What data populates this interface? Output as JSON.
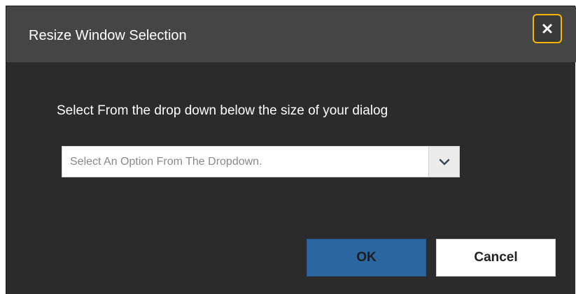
{
  "dialog": {
    "title": "Resize Window Selection",
    "close_icon": "close-icon",
    "prompt": "Select From the drop down below the size of your dialog",
    "dropdown": {
      "placeholder": "Select An Option From The Dropdown.",
      "arrow_icon": "chevron-down-icon"
    },
    "buttons": {
      "ok_label": "OK",
      "cancel_label": "Cancel"
    }
  },
  "colors": {
    "header_bg": "#454545",
    "body_bg": "#2b2b2b",
    "close_border": "#f2b705",
    "ok_bg": "#2a67a0",
    "cancel_bg": "#ffffff"
  }
}
